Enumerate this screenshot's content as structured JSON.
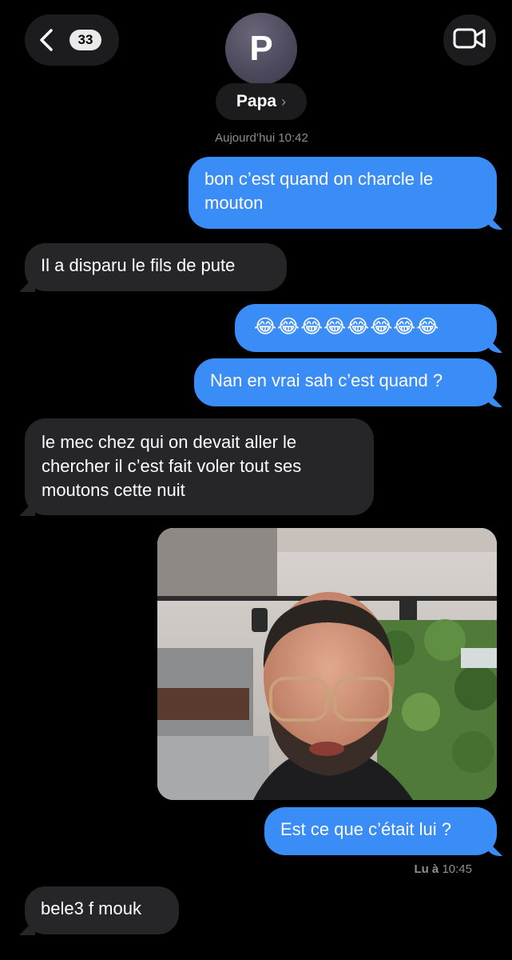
{
  "header": {
    "back_count": "33",
    "avatar_initial": "P",
    "contact_name": "Papa",
    "name_chevron": "›"
  },
  "timestamp": "Aujourd’hui 10:42",
  "messages": [
    {
      "direction": "out",
      "text": "bon c’est quand on charcle le mouton"
    },
    {
      "direction": "in",
      "text": "Il a disparu le fils de pute"
    },
    {
      "direction": "out",
      "text": "😂😂😂😂😂😂😂😂"
    },
    {
      "direction": "out",
      "text": "Nan en vrai sah c’est quand ?"
    },
    {
      "direction": "in",
      "text": "le mec chez qui on devait aller le chercher il c’est fait voler tout ses moutons cette nuit"
    },
    {
      "direction": "out",
      "text": "Est ce que c’était lui ?"
    },
    {
      "direction": "in",
      "text": "bele3 f mouk"
    }
  ],
  "read_receipt": {
    "label": "Lu à",
    "time": "10:45"
  },
  "colors": {
    "outgoing_bubble": "#3a8cf7",
    "incoming_bubble": "#262629",
    "background": "#000000"
  },
  "icons": [
    "back-chevron-icon",
    "video-call-icon"
  ]
}
